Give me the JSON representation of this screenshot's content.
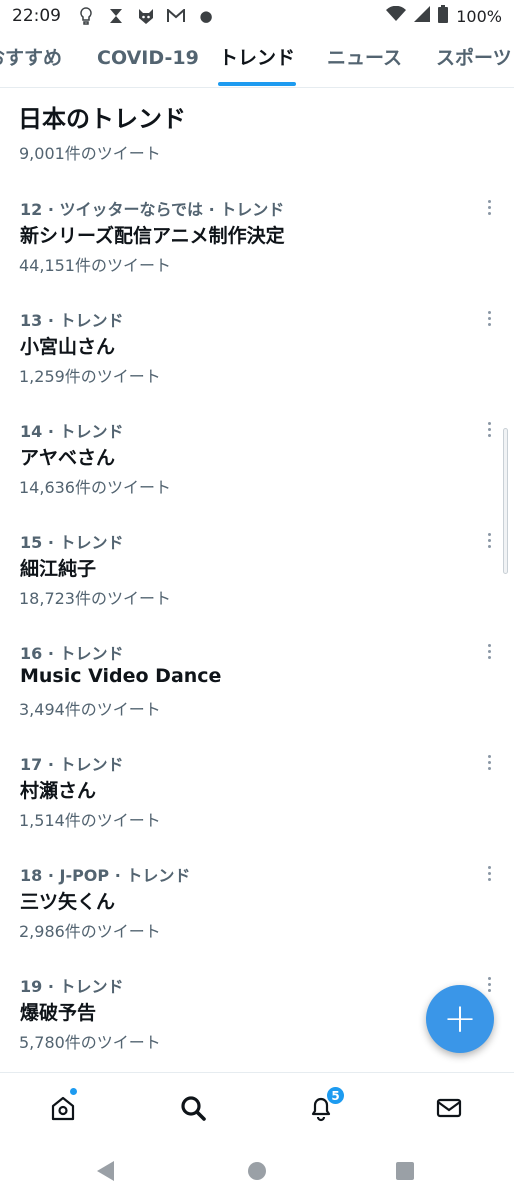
{
  "status_bar": {
    "time": "22:09",
    "battery": "100%",
    "icons": [
      "lightbulb-icon",
      "hourglass-icon",
      "fox-icon",
      "mail-icon",
      "wifi-icon",
      "signal-icon",
      "battery-icon"
    ]
  },
  "tabs": [
    {
      "label": "おすすめ",
      "active": false
    },
    {
      "label": "COVID-19",
      "active": false
    },
    {
      "label": "トレンド",
      "active": true
    },
    {
      "label": "ニュース",
      "active": false
    },
    {
      "label": "スポーツ",
      "active": false
    }
  ],
  "section": {
    "title": "日本のトレンド",
    "first_count": "9,001件のツイート"
  },
  "trends": [
    {
      "meta": "12 · ツイッターならでは · トレンド",
      "name": "新シリーズ配信アニメ制作決定",
      "count": "44,151件のツイート"
    },
    {
      "meta": "13 · トレンド",
      "name": "小宮山さん",
      "count": "1,259件のツイート"
    },
    {
      "meta": "14 · トレンド",
      "name": "アヤベさん",
      "count": "14,636件のツイート"
    },
    {
      "meta": "15 · トレンド",
      "name": "細江純子",
      "count": "18,723件のツイート"
    },
    {
      "meta": "16 · トレンド",
      "name": "Music Video Dance",
      "count": "3,494件のツイート"
    },
    {
      "meta": "17 · トレンド",
      "name": "村瀬さん",
      "count": "1,514件のツイート"
    },
    {
      "meta": "18 · J-POP · トレンド",
      "name": "三ツ矢くん",
      "count": "2,986件のツイート"
    },
    {
      "meta": "19 · トレンド",
      "name": "爆破予告",
      "count": "5,780件のツイート"
    }
  ],
  "fab": {
    "label": "+"
  },
  "bottom_nav": {
    "notifications_badge": "5"
  },
  "colors": {
    "accent": "#1d9bf0",
    "fab": "#3a96e8",
    "text_primary": "#0f1419",
    "text_secondary": "#536471"
  }
}
